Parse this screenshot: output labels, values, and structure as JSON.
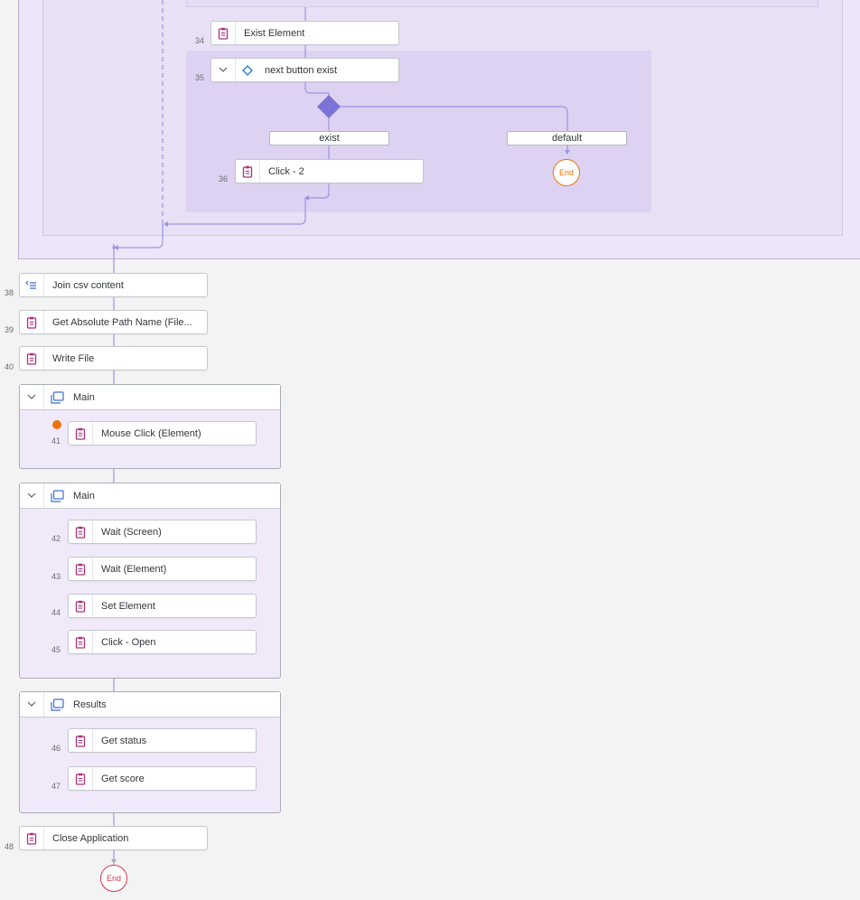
{
  "colors": {
    "connector": "#9d94e0",
    "step_icon": "#b0307b",
    "condition_icon": "#1a7bd2",
    "join_icon": "#3b6fd8",
    "group_icon": "#3b6fd8",
    "end_orange": "#e9730c",
    "end_red": "#d9364c",
    "breakpoint": "#e9730c"
  },
  "steps": {
    "s34": {
      "num": "34",
      "label": "Exist Element",
      "icon": "clipboard-icon"
    },
    "s35": {
      "num": "35",
      "label": "next button exist",
      "icon": "diamond-condition-icon"
    },
    "s36": {
      "num": "36",
      "label": "Click - 2",
      "icon": "clipboard-icon"
    },
    "s38": {
      "num": "38",
      "label": "Join csv content",
      "icon": "join-icon"
    },
    "s39": {
      "num": "39",
      "label": "Get Absolute Path Name (File...",
      "icon": "clipboard-icon"
    },
    "s40": {
      "num": "40",
      "label": "Write File",
      "icon": "clipboard-icon"
    },
    "s41": {
      "num": "41",
      "label": "Mouse Click (Element)",
      "icon": "clipboard-icon"
    },
    "s42": {
      "num": "42",
      "label": "Wait (Screen)",
      "icon": "clipboard-icon"
    },
    "s43": {
      "num": "43",
      "label": "Wait (Element)",
      "icon": "clipboard-icon"
    },
    "s44": {
      "num": "44",
      "label": "Set Element",
      "icon": "clipboard-icon"
    },
    "s45": {
      "num": "45",
      "label": "Click - Open",
      "icon": "clipboard-icon"
    },
    "s46": {
      "num": "46",
      "label": "Get status",
      "icon": "clipboard-icon"
    },
    "s47": {
      "num": "47",
      "label": "Get score",
      "icon": "clipboard-icon"
    },
    "s48": {
      "num": "48",
      "label": "Close Application",
      "icon": "clipboard-icon"
    }
  },
  "branches": {
    "exist": "exist",
    "default": "default"
  },
  "groups": {
    "g1": "Main",
    "g2": "Main",
    "g3": "Results"
  },
  "ends": {
    "branch_end": "End",
    "flow_end": "End"
  }
}
